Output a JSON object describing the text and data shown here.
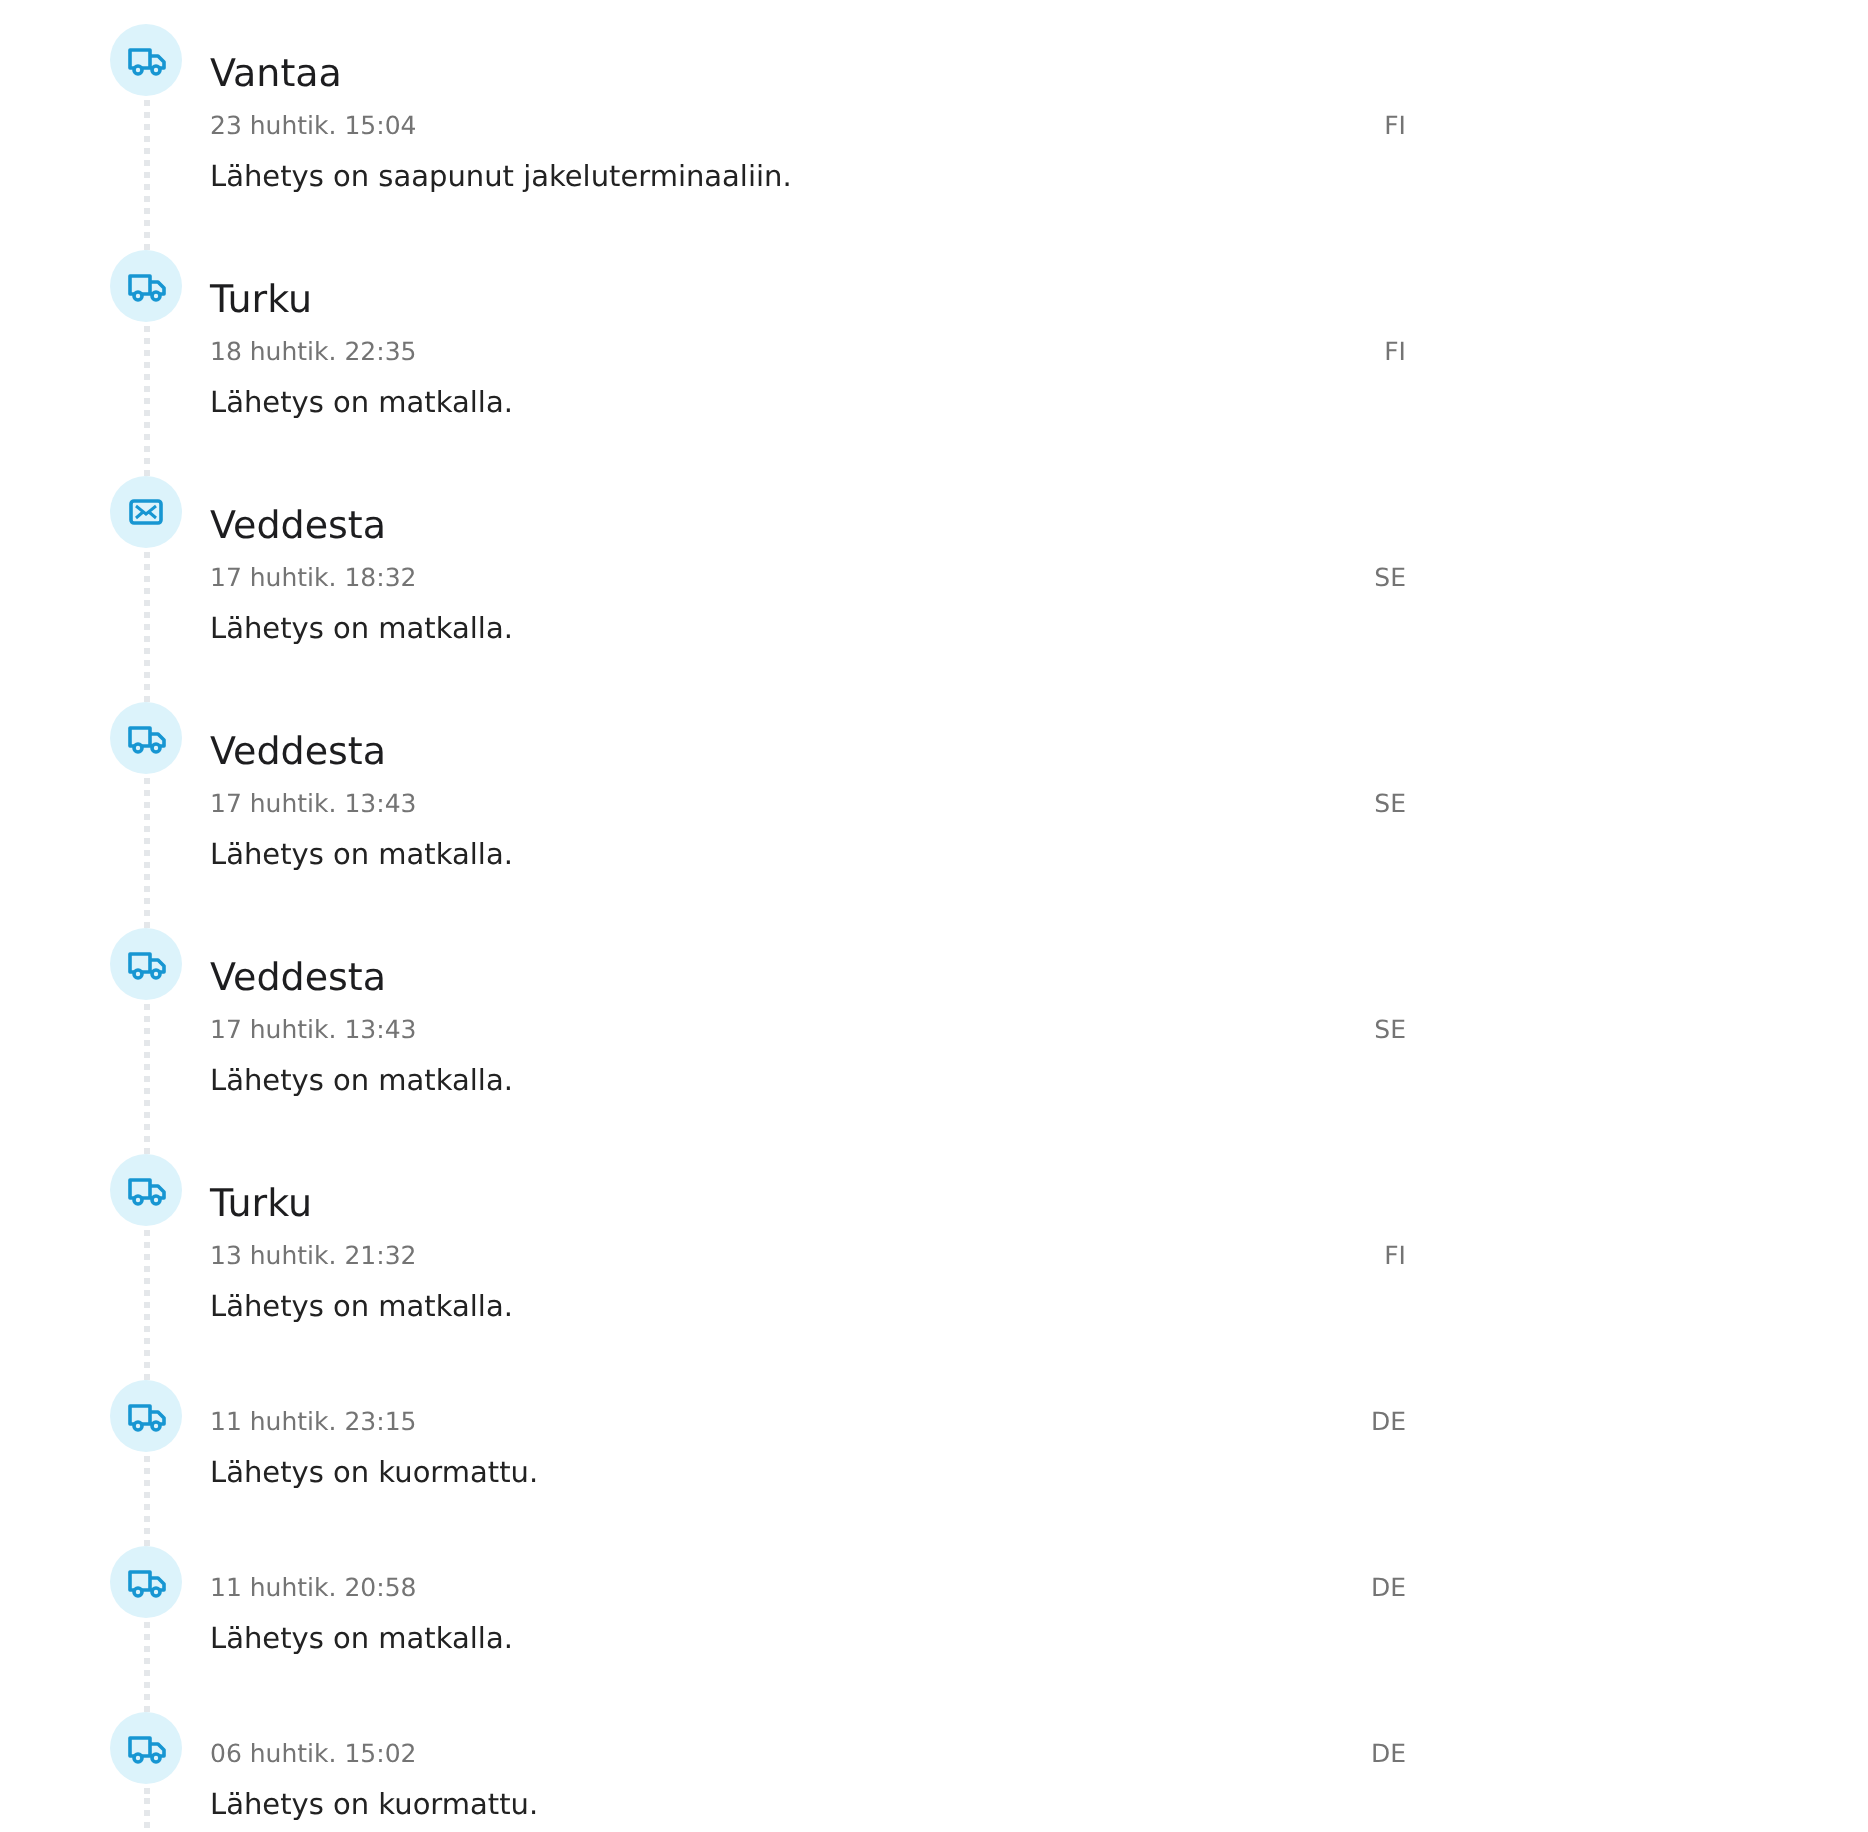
{
  "events": [
    {
      "kind": "truck",
      "location": "Vantaa",
      "date": "23 huhtik. 15:04",
      "country": "FI",
      "message": "Lähetys on saapunut jakeluterminaaliin."
    },
    {
      "kind": "truck",
      "location": "Turku",
      "date": "18 huhtik. 22:35",
      "country": "FI",
      "message": "Lähetys on matkalla."
    },
    {
      "kind": "mail",
      "location": "Veddesta",
      "date": "17 huhtik. 18:32",
      "country": "SE",
      "message": "Lähetys on matkalla."
    },
    {
      "kind": "truck",
      "location": "Veddesta",
      "date": "17 huhtik. 13:43",
      "country": "SE",
      "message": "Lähetys on matkalla."
    },
    {
      "kind": "truck",
      "location": "Veddesta",
      "date": "17 huhtik. 13:43",
      "country": "SE",
      "message": "Lähetys on matkalla."
    },
    {
      "kind": "truck",
      "location": "Turku",
      "date": "13 huhtik. 21:32",
      "country": "FI",
      "message": "Lähetys on matkalla."
    },
    {
      "kind": "truck",
      "date": "11 huhtik. 23:15",
      "country": "DE",
      "message": "Lähetys on kuormattu."
    },
    {
      "kind": "truck",
      "date": "11 huhtik. 20:58",
      "country": "DE",
      "message": "Lähetys on matkalla."
    },
    {
      "kind": "truck",
      "date": "06 huhtik. 15:02",
      "country": "DE",
      "message": "Lähetys on kuormattu."
    }
  ]
}
